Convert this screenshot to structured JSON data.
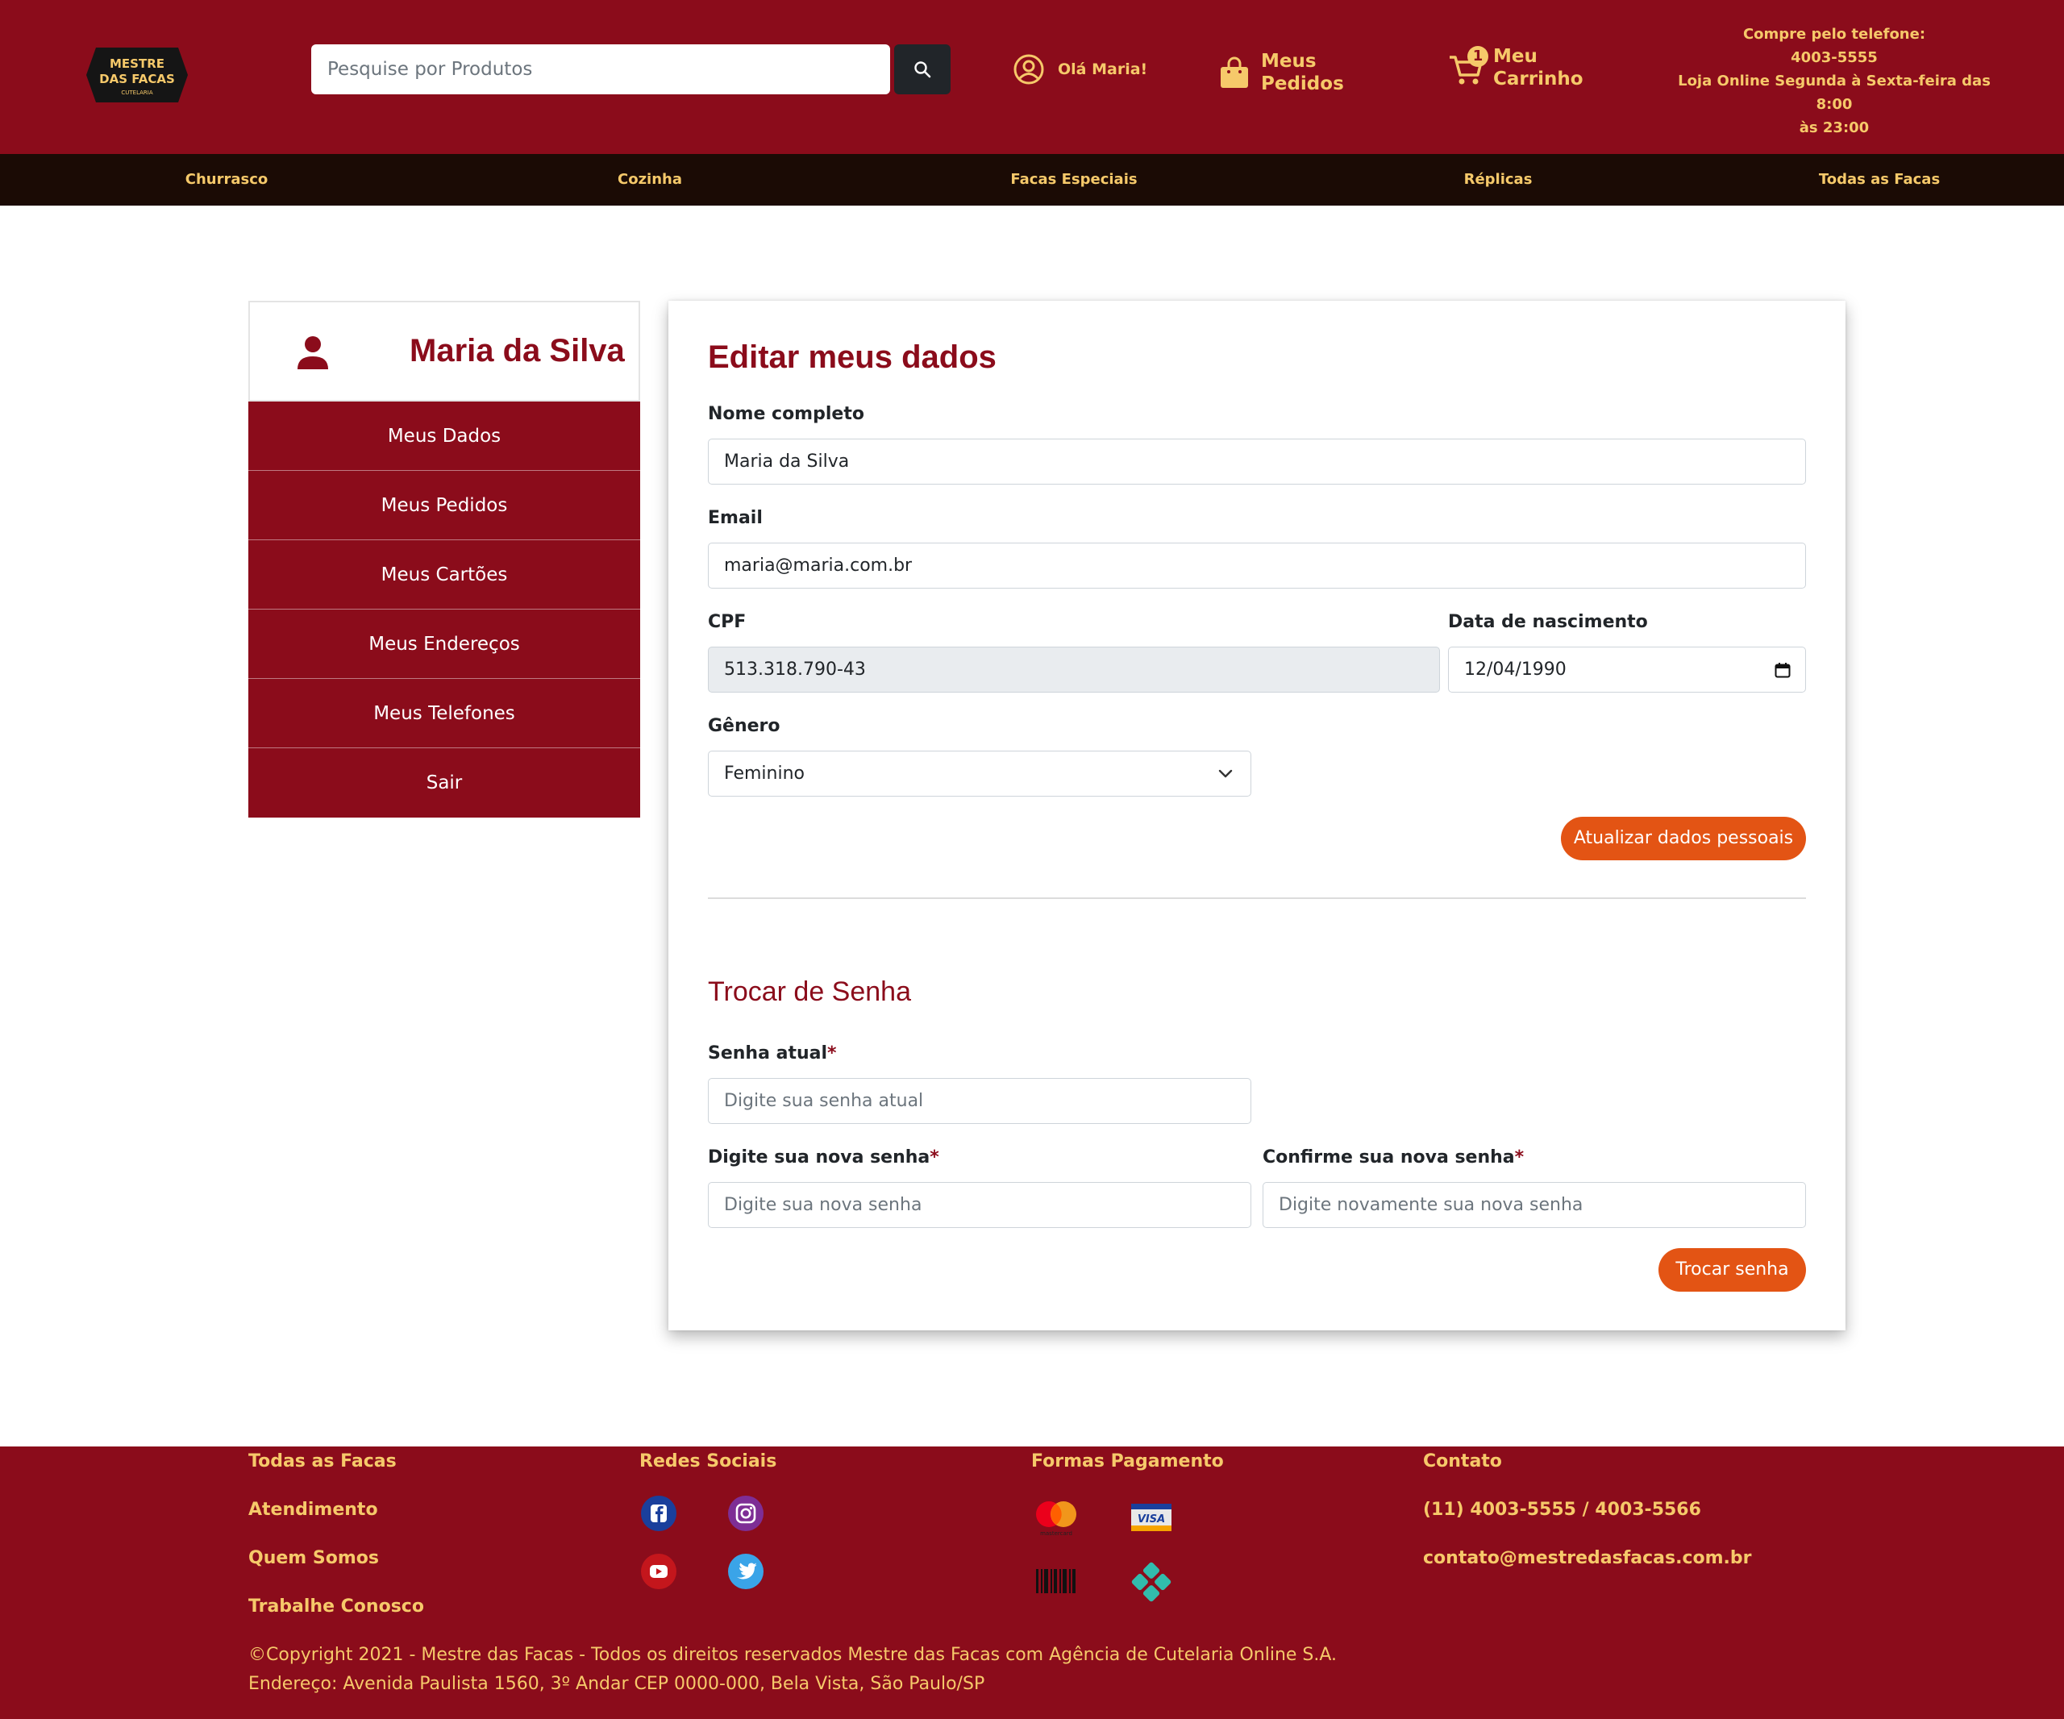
{
  "header": {
    "logo_line1": "MESTRE",
    "logo_line2": "DAS FACAS",
    "logo_line3": "CUTELARIA",
    "search_placeholder": "Pesquise por Produtos",
    "user_greeting": "Olá Maria!",
    "orders_line1": "Meus",
    "orders_line2": "Pedidos",
    "cart_count": "1",
    "cart_line1": "Meu",
    "cart_line2": "Carrinho",
    "phone_line1": "Compre pelo telefone:",
    "phone_line2": "4003-5555",
    "phone_line3": "Loja Online Segunda à Sexta-feira das 8:00",
    "phone_line4": "às 23:00"
  },
  "nav": [
    "Churrasco",
    "Cozinha",
    "Facas Especiais",
    "Réplicas",
    "Todas as Facas"
  ],
  "sidebar": {
    "user_name": "Maria da Silva",
    "items": [
      "Meus Dados",
      "Meus Pedidos",
      "Meus Cartões",
      "Meus Endereços",
      "Meus Telefones",
      "Sair"
    ]
  },
  "form": {
    "title": "Editar meus dados",
    "name_label": "Nome completo",
    "name_value": "Maria da Silva",
    "email_label": "Email",
    "email_value": "maria@maria.com.br",
    "cpf_label": "CPF",
    "cpf_value": "513.318.790-43",
    "birth_label": "Data de nascimento",
    "birth_value": "12/04/1990",
    "gender_label": "Gênero",
    "gender_value": "Feminino",
    "update_button": "Atualizar dados pessoais"
  },
  "password": {
    "title": "Trocar de Senha",
    "current_label": "Senha atual",
    "current_placeholder": "Digite sua senha atual",
    "new_label": "Digite sua nova senha",
    "new_placeholder": "Digite sua nova senha",
    "confirm_label": "Confirme sua nova senha",
    "confirm_placeholder": "Digite novamente sua nova senha",
    "required_mark": "*",
    "button": "Trocar senha"
  },
  "footer": {
    "links": [
      "Todas as Facas",
      "Atendimento",
      "Quem Somos",
      "Trabalhe Conosco"
    ],
    "social_title": "Redes Sociais",
    "payment_title": "Formas Pagamento",
    "mastercard_label": "mastercard",
    "visa_label": "VISA",
    "contact_title": "Contato",
    "contact_phone": "(11) 4003-5555 / 4003-5566",
    "contact_email": "contato@mestredasfacas.com.br",
    "copyright": "©Copyright 2021 - Mestre das Facas - Todos os direitos reservados Mestre das Facas com Agência de Cutelaria Online S.A.",
    "address": "Endereço: Avenida Paulista 1560, 3º Andar CEP 0000-000, Bela Vista, São Paulo/SP"
  },
  "colors": {
    "brand": "#8b0c1b",
    "accent": "#e35414",
    "gold": "#f6c96a",
    "nav_bg": "#1b0b05"
  }
}
